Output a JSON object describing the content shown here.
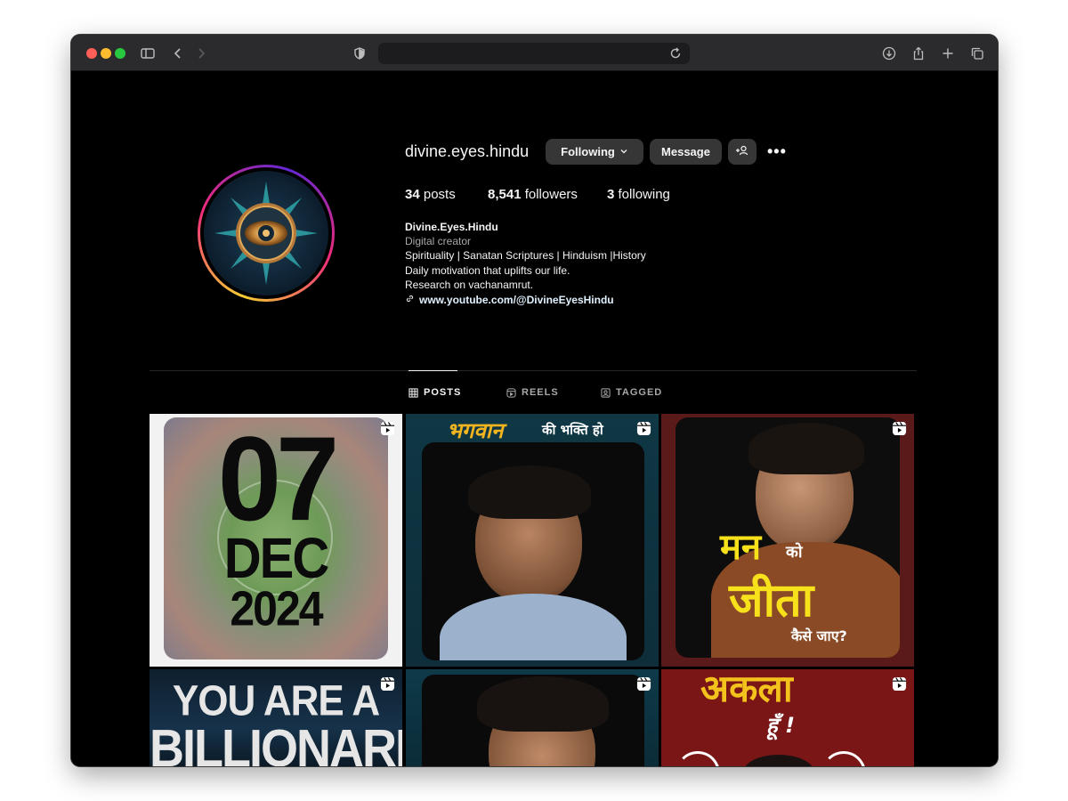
{
  "profile": {
    "username": "divine.eyes.hindu",
    "following_label": "Following",
    "message_label": "Message",
    "more_label": "•••",
    "stats": {
      "posts_count": "34",
      "posts_label": "posts",
      "followers_count": "8,541",
      "followers_label": "followers",
      "following_count": "3",
      "following_label": "following"
    },
    "bio": {
      "display_name": "Divine.Eyes.Hindu",
      "category": "Digital creator",
      "line1": "Spirituality | Sanatan Scriptures | Hinduism |History",
      "line2": "Daily motivation that uplifts our life.",
      "line3": "Research on vachanamrut.",
      "link": "www.youtube.com/@DivineEyesHindu"
    }
  },
  "tabs": [
    {
      "label": "POSTS",
      "icon": "grid-icon",
      "active": true
    },
    {
      "label": "REELS",
      "icon": "reels-icon",
      "active": false
    },
    {
      "label": "TAGGED",
      "icon": "tagged-icon",
      "active": false
    }
  ],
  "posts": [
    {
      "type": "reel",
      "text_big": "07",
      "text_mid": "DEC",
      "text_small": "2024"
    },
    {
      "type": "reel",
      "text_top": "भगवान",
      "text_top2": "की भक्ति हो"
    },
    {
      "type": "reel",
      "text_a": "मन",
      "text_b": "को",
      "text_c": "जीता",
      "text_d": "कैसे जाए?"
    },
    {
      "type": "reel",
      "text_a": "YOU ARE A",
      "text_b": "BILLIONARE"
    },
    {
      "type": "reel"
    },
    {
      "type": "reel",
      "text_a": "अकला",
      "text_b": "हूँ !"
    }
  ],
  "colors": {
    "background": "#000000",
    "button_bg": "#363636",
    "text_primary": "#f5f5f5",
    "text_secondary": "#a8a8a8",
    "titlebar": "#2b2b2d",
    "ring_yellow": "#f9ce34",
    "ring_pink": "#ee2a7b",
    "ring_purple": "#6228d7"
  }
}
